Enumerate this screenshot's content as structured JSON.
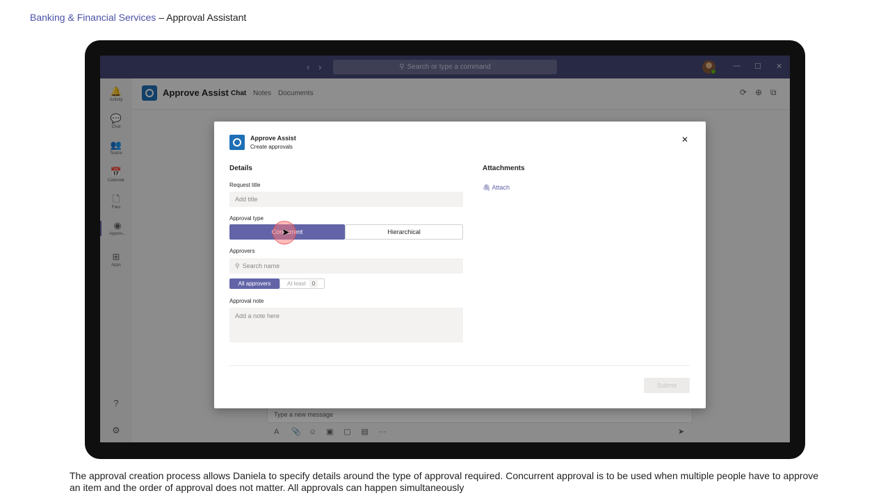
{
  "page": {
    "title_part1": "Banking & Financial Services",
    "title_sep": " – ",
    "title_part2": "Approval Assistant",
    "caption": "The approval creation process allows Daniela to specify details around the type of approval required. Concurrent approval is to be used when multiple people have to approve an item and the order of approval does not matter. All approvals can happen simultaneously"
  },
  "titlebar": {
    "back_icon": "‹",
    "forward_icon": "›",
    "search_icon": "⚲",
    "search_placeholder": "Search or type a command",
    "minimize": "—",
    "maximize": "☐",
    "close": "✕"
  },
  "rail": {
    "items": [
      {
        "icon": "🔔",
        "label": "Activity"
      },
      {
        "icon": "💬",
        "label": "Chat"
      },
      {
        "icon": "👥",
        "label": "Teams"
      },
      {
        "icon": "📅",
        "label": "Calendar"
      },
      {
        "icon": "🗋",
        "label": "Files"
      },
      {
        "icon": "◉",
        "label": "Approv..."
      },
      {
        "icon": "⊞",
        "label": "Apps"
      }
    ],
    "help_icon": "?",
    "settings_icon": "⚙"
  },
  "header": {
    "app_title": "Approve Assist",
    "tabs": [
      "Chat",
      "Notes",
      "Documents"
    ],
    "refresh_icon": "⟳",
    "globe_icon": "⊕",
    "popout_icon": "⧉"
  },
  "compose": {
    "placeholder": "Type a new message",
    "tools": [
      "A",
      "📎",
      "☺",
      "▣",
      "▢",
      "▤",
      "···"
    ],
    "send_icon": "➤"
  },
  "dialog": {
    "app_name": "Approve Assist",
    "subtitle": "Create approvals",
    "close_icon": "✕",
    "details_title": "Details",
    "request_title_label": "Request title",
    "request_title_placeholder": "Add title",
    "approval_type_label": "Approval type",
    "type_concurrent": "Concurrent",
    "type_hierarchical": "Hierarchical",
    "approvers_label": "Approvers",
    "search_icon": "⚲",
    "approvers_placeholder": "Search name",
    "all_approvers": "All approvers",
    "at_least": "At least",
    "at_least_count": "0",
    "approval_note_label": "Approval note",
    "approval_note_placeholder": "Add a note here",
    "attachments_title": "Attachments",
    "attach_icon": "🖇",
    "attach_label": "Attach",
    "submit_label": "Submit"
  }
}
